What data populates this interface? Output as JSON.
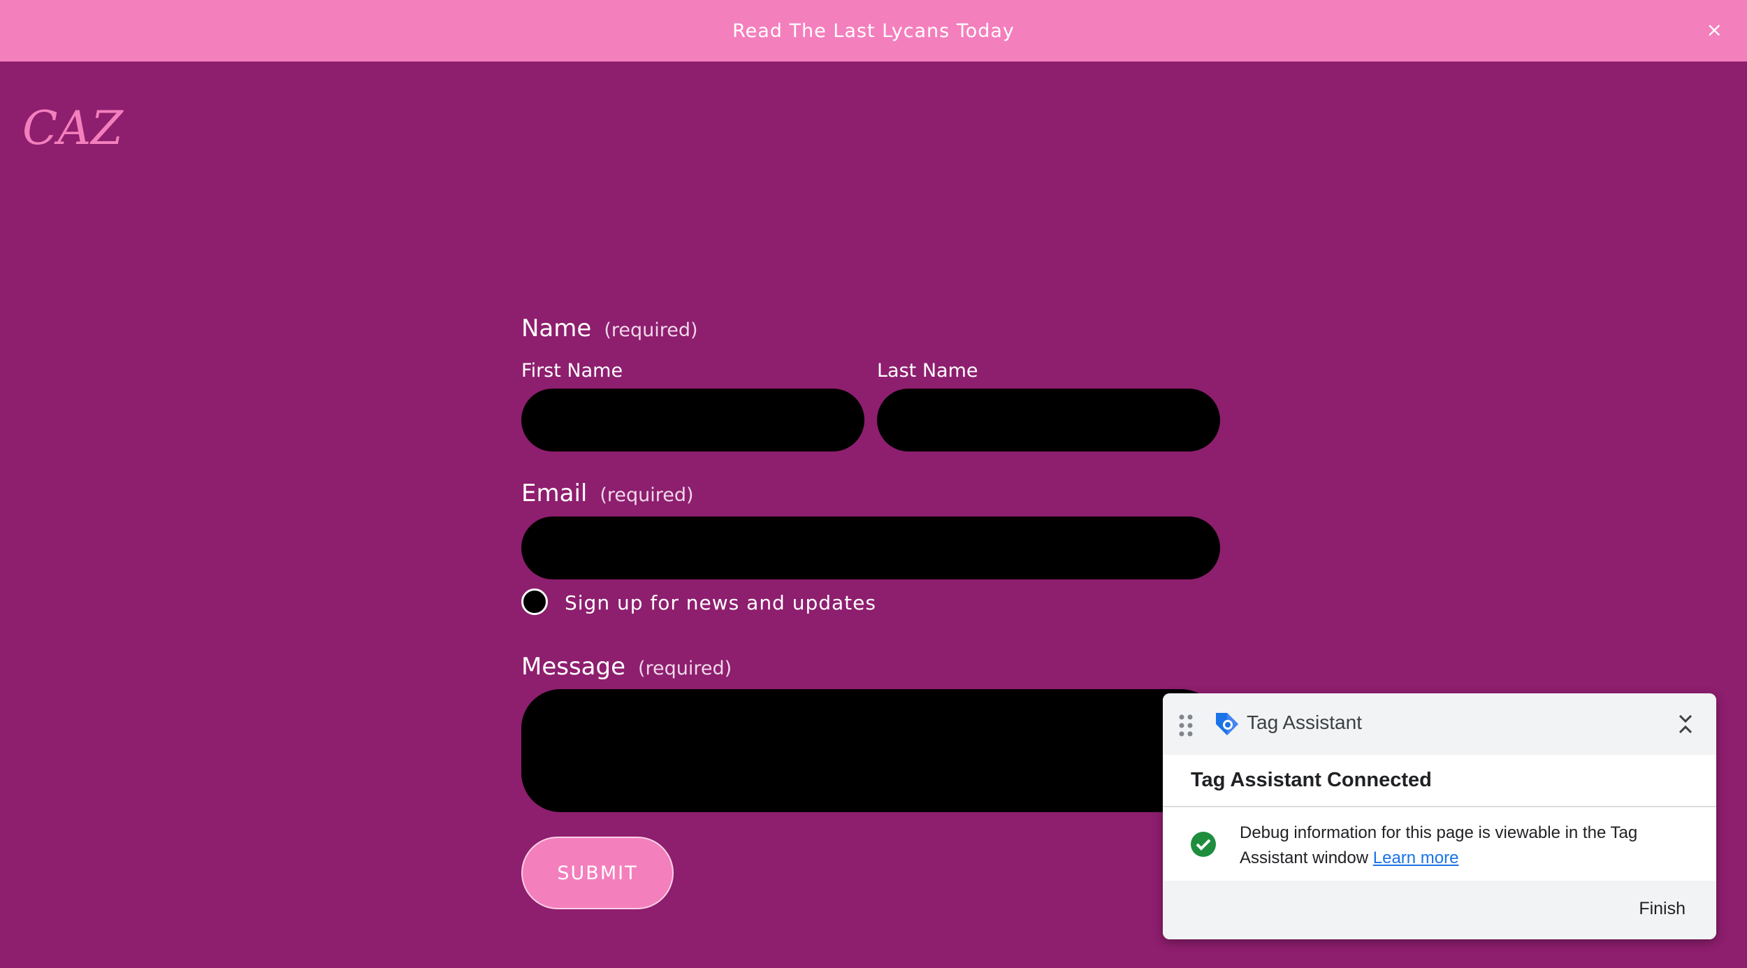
{
  "banner": {
    "text": "Read The Last Lycans Today",
    "close": "×"
  },
  "logo": {
    "text": "CAZ"
  },
  "form": {
    "name": {
      "label": "Name",
      "required": "(required)",
      "first_label": "First Name",
      "last_label": "Last Name"
    },
    "email": {
      "label": "Email",
      "required": "(required)"
    },
    "signup": {
      "label": "Sign up for news and updates"
    },
    "message": {
      "label": "Message",
      "required": "(required)"
    },
    "submit_label": "SUBMIT"
  },
  "tag_assistant": {
    "title": "Tag Assistant",
    "heading": "Tag Assistant Connected",
    "message": "Debug information for this page is viewable in the Tag Assistant window",
    "link": "Learn more",
    "finish": "Finish"
  },
  "colors": {
    "background": "#8e1e6e",
    "banner": "#f47fbd",
    "input": "#000000",
    "link": "#1a73e8",
    "success": "#1e8e3e"
  }
}
